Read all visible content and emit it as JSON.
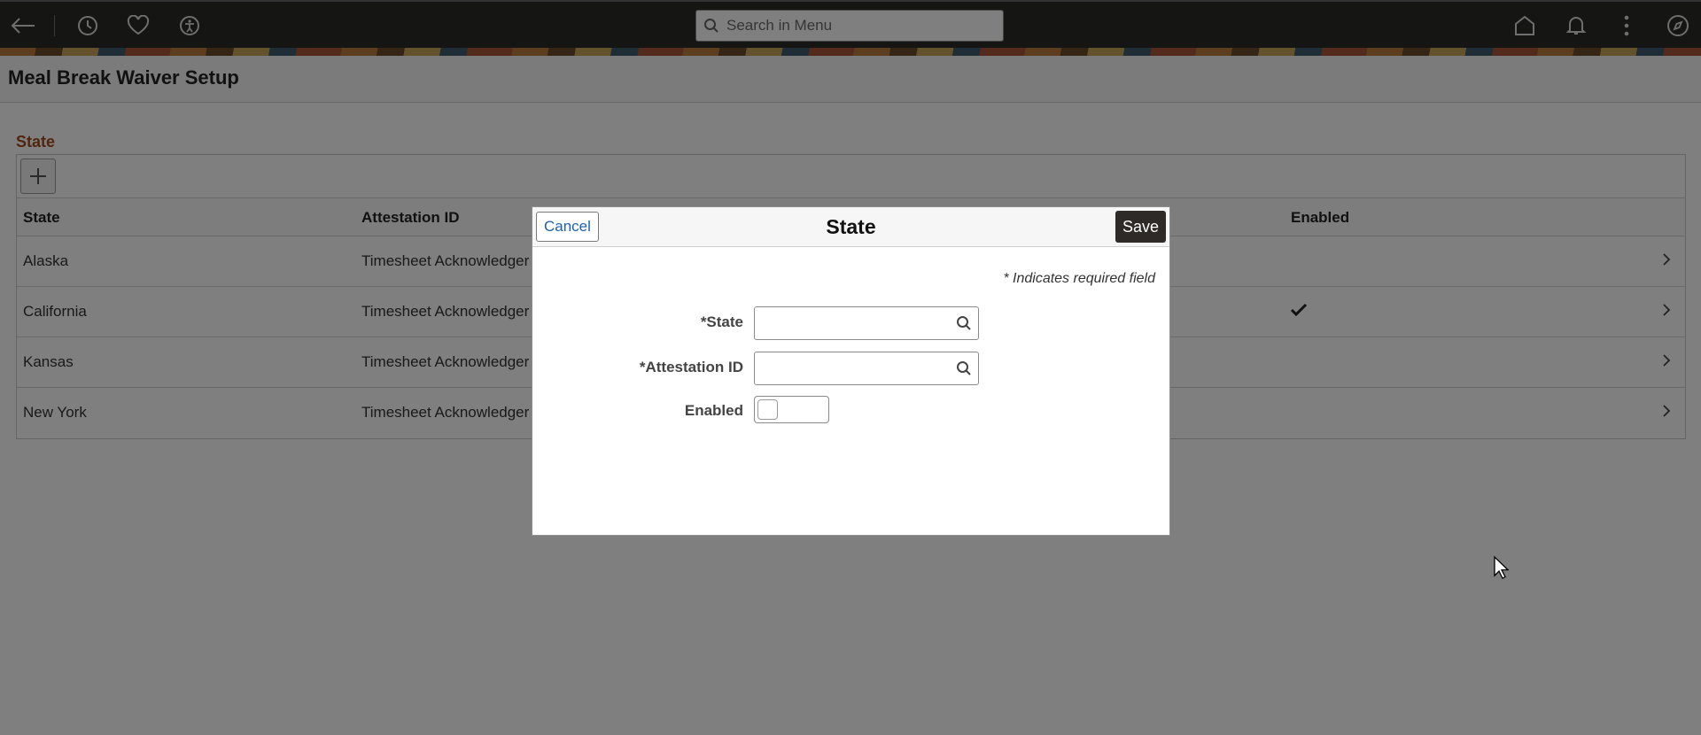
{
  "header": {
    "search_placeholder": "Search in Menu"
  },
  "page": {
    "title": "Meal Break Waiver Setup"
  },
  "grid": {
    "title": "State",
    "columns": [
      "State",
      "Attestation ID",
      "Enabled"
    ],
    "rows": [
      {
        "state": "Alaska",
        "attestation": "Timesheet Acknowledger",
        "enabled": false
      },
      {
        "state": "California",
        "attestation": "Timesheet Acknowledger",
        "enabled": true
      },
      {
        "state": "Kansas",
        "attestation": "Timesheet Acknowledger",
        "enabled": false
      },
      {
        "state": "New York",
        "attestation": "Timesheet Acknowledger",
        "enabled": false
      }
    ]
  },
  "modal": {
    "title": "State",
    "cancel_label": "Cancel",
    "save_label": "Save",
    "required_note": "* Indicates required field",
    "fields": {
      "state_label": "*State",
      "state_value": "",
      "attestation_label": "*Attestation ID",
      "attestation_value": "",
      "enabled_label": "Enabled",
      "enabled_value": false
    }
  },
  "icons": {
    "back": "back-arrow-icon",
    "recent": "clock-icon",
    "favorites": "heart-icon",
    "accessibility": "accessibility-icon",
    "home": "home-icon",
    "notifications": "bell-icon",
    "actions": "kebab-menu-icon",
    "navigator": "compass-icon"
  },
  "colors": {
    "topbar": "#2b2a29",
    "grid_title": "#a24b1f",
    "link": "#1d62a8",
    "save_button": "#2e2a27"
  }
}
